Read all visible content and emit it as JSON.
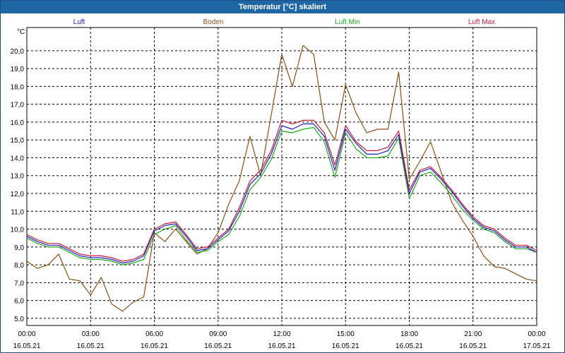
{
  "window": {
    "title": "Temperatur [°C] skaliert"
  },
  "colors": {
    "luft": "#1f1fbf",
    "boden": "#8b4e14",
    "luft_min": "#1aa81a",
    "luft_max": "#c21c3a",
    "grid": "#000000",
    "title_bar": "#1f66a4"
  },
  "chart_data": {
    "type": "line",
    "title": "Temperatur [°C] skaliert",
    "xlabel": "",
    "ylabel": "°C",
    "unit": "°C",
    "grid": true,
    "legend": "top",
    "xlim": [
      0,
      24
    ],
    "ylim": [
      4.6,
      21.3
    ],
    "x_ticks": [
      {
        "x": 0,
        "time": "00:00",
        "date": "16.05.21"
      },
      {
        "x": 3,
        "time": "03:00",
        "date": "16.05.21"
      },
      {
        "x": 6,
        "time": "06:00",
        "date": "16.05.21"
      },
      {
        "x": 9,
        "time": "09:00",
        "date": "16.05.21"
      },
      {
        "x": 12,
        "time": "12:00",
        "date": "16.05.21"
      },
      {
        "x": 15,
        "time": "15:00",
        "date": "16.05.21"
      },
      {
        "x": 18,
        "time": "18:00",
        "date": "16.05.21"
      },
      {
        "x": 21,
        "time": "21:00",
        "date": "16.05.21"
      },
      {
        "x": 24,
        "time": "00:00",
        "date": "17.05.21"
      }
    ],
    "y_ticks": [
      "5,0",
      "6,0",
      "7,0",
      "8,0",
      "9,0",
      "10,0",
      "11,0",
      "12,0",
      "13,0",
      "14,0",
      "15,0",
      "16,0",
      "17,0",
      "18,0",
      "19,0",
      "20,0"
    ],
    "x": [
      0,
      0.5,
      1,
      1.5,
      2,
      2.5,
      3,
      3.5,
      4,
      4.5,
      5,
      5.5,
      6,
      6.5,
      7,
      7.5,
      8,
      8.5,
      9,
      9.5,
      10,
      10.5,
      11,
      11.5,
      12,
      12.5,
      13,
      13.5,
      14,
      14.5,
      15,
      15.5,
      16,
      16.5,
      17,
      17.5,
      18,
      18.5,
      19,
      19.5,
      20,
      20.5,
      21,
      21.5,
      22,
      22.5,
      23,
      23.5,
      24
    ],
    "series": [
      {
        "name": "Luft",
        "values": [
          9.6,
          9.3,
          9.1,
          9.1,
          8.8,
          8.5,
          8.4,
          8.4,
          8.3,
          8.1,
          8.2,
          8.5,
          9.9,
          10.2,
          10.3,
          9.6,
          8.8,
          8.9,
          9.4,
          9.9,
          11.0,
          12.5,
          13.1,
          14.2,
          15.8,
          15.6,
          15.9,
          15.9,
          15.2,
          13.3,
          15.6,
          14.8,
          14.2,
          14.2,
          14.4,
          15.3,
          12.0,
          13.2,
          13.4,
          12.8,
          12.1,
          11.3,
          10.6,
          10.1,
          9.9,
          9.4,
          9.0,
          9.0,
          8.7
        ]
      },
      {
        "name": "Boden",
        "values": [
          8.2,
          7.8,
          8.0,
          8.6,
          7.2,
          7.1,
          6.3,
          7.3,
          5.8,
          5.4,
          5.9,
          6.2,
          9.8,
          9.3,
          10.0,
          9.3,
          8.6,
          8.9,
          9.8,
          11.4,
          12.7,
          15.2,
          13.0,
          16.4,
          19.8,
          18.0,
          20.3,
          19.8,
          16.0,
          15.0,
          18.1,
          16.5,
          15.4,
          15.6,
          15.6,
          18.8,
          12.8,
          13.8,
          14.9,
          13.2,
          11.5,
          10.5,
          9.6,
          8.5,
          7.9,
          7.8,
          7.5,
          7.2,
          7.1
        ]
      },
      {
        "name": "Luft Min",
        "values": [
          9.5,
          9.2,
          9.0,
          9.0,
          8.7,
          8.4,
          8.3,
          8.3,
          8.2,
          8.0,
          8.1,
          8.3,
          9.7,
          10.0,
          10.2,
          9.4,
          8.7,
          8.8,
          9.3,
          9.7,
          10.7,
          12.2,
          12.9,
          13.9,
          15.5,
          15.4,
          15.6,
          15.7,
          14.9,
          12.9,
          15.4,
          14.5,
          14.0,
          14.0,
          14.1,
          15.1,
          11.7,
          13.0,
          13.2,
          12.6,
          11.9,
          11.1,
          10.5,
          10.0,
          9.8,
          9.3,
          8.9,
          8.9,
          8.7
        ]
      },
      {
        "name": "Luft Max",
        "values": [
          9.7,
          9.4,
          9.2,
          9.2,
          8.9,
          8.6,
          8.5,
          8.5,
          8.4,
          8.2,
          8.3,
          8.6,
          10.0,
          10.3,
          10.4,
          9.7,
          8.9,
          9.0,
          9.5,
          10.0,
          11.2,
          12.7,
          13.3,
          14.4,
          16.1,
          15.9,
          16.1,
          16.1,
          15.4,
          13.6,
          15.8,
          14.9,
          14.4,
          14.4,
          14.6,
          15.5,
          12.2,
          13.3,
          13.5,
          12.9,
          12.2,
          11.4,
          10.7,
          10.2,
          10.0,
          9.5,
          9.1,
          9.1,
          8.8
        ]
      }
    ]
  }
}
